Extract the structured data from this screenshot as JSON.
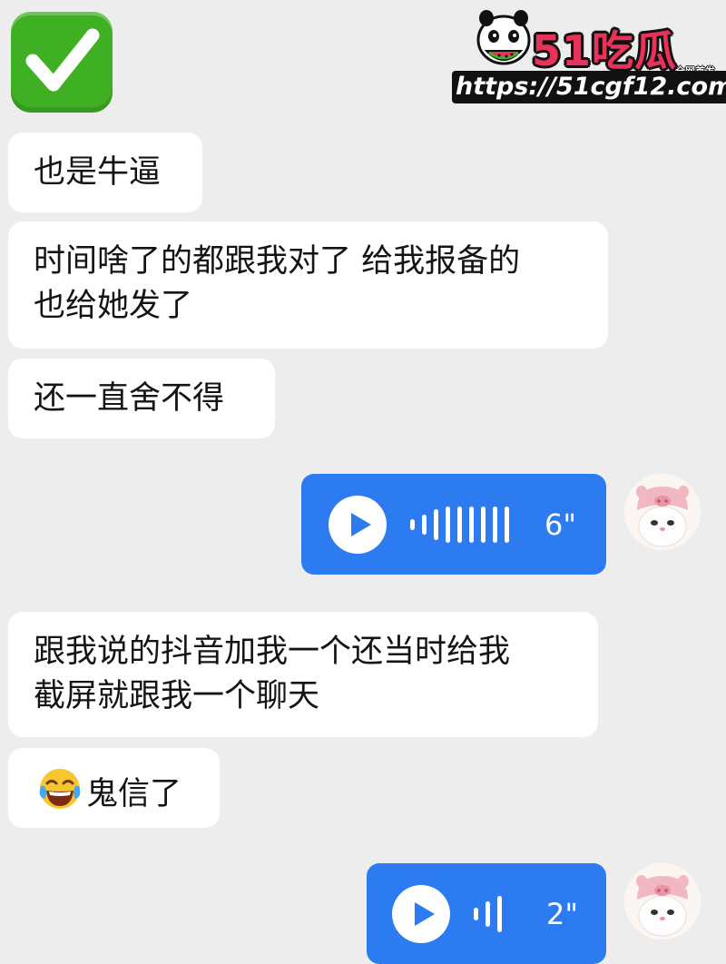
{
  "reaction_emoji": "check-mark-emoji",
  "watermark": {
    "brand": "51吃瓜",
    "tag": "全网首发",
    "url": "https://51cgf12.com"
  },
  "messages": [
    {
      "type": "text",
      "side": "left",
      "lines": [
        "也是牛逼"
      ]
    },
    {
      "type": "text",
      "side": "left",
      "lines": [
        "时间啥了的都跟我对了 给我报备的",
        "也给她发了"
      ]
    },
    {
      "type": "text",
      "side": "left",
      "lines": [
        "还一直舍不得"
      ]
    },
    {
      "type": "voice",
      "side": "right",
      "duration": "6\"",
      "avatar": "pig-hat-character"
    },
    {
      "type": "text",
      "side": "left",
      "lines": [
        "跟我说的抖音加我一个还当时给我",
        "截屏就跟我一个聊天"
      ]
    },
    {
      "type": "text",
      "side": "left",
      "emoji": "tears-of-joy",
      "lines": [
        "鬼信了"
      ]
    },
    {
      "type": "voice",
      "side": "right",
      "duration": "2\"",
      "avatar": "pig-hat-character"
    }
  ],
  "colors": {
    "background": "#ededed",
    "incoming_bubble": "#ffffff",
    "voice_bubble": "#2d7bf0",
    "check_green": "#3fb024",
    "brand_pink": "#e8325a"
  }
}
